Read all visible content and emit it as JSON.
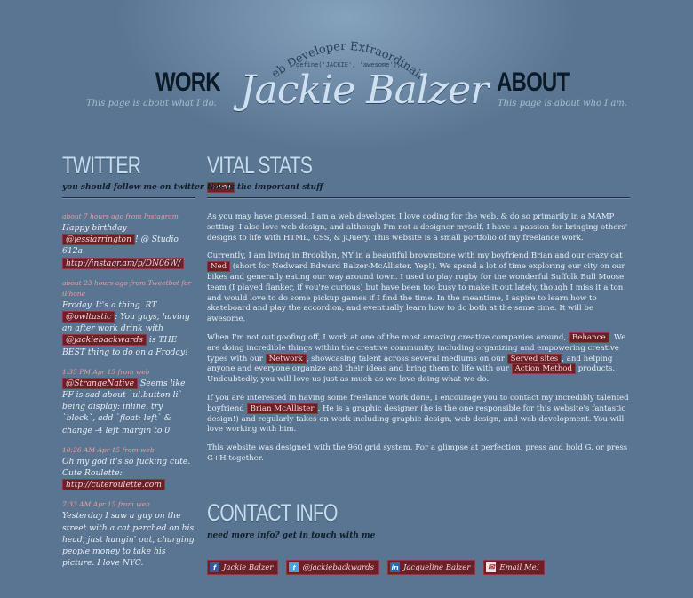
{
  "header": {
    "tagline": "Web Developer Extraordinaire",
    "code": "define('JACKIE', 'awesome');",
    "name": "Jackie Balzer",
    "work": {
      "title": "WORK",
      "subtitle": "This page is about what I do."
    },
    "about": {
      "title": "ABOUT",
      "subtitle": "This page is about who I am."
    }
  },
  "twitter": {
    "heading": "TWITTER",
    "sub_prefix": "you should follow me on twitter",
    "sub_link": "here",
    "tweets": [
      {
        "meta": "about 7 hours ago from Instagram",
        "t1": "Happy birthday ",
        "l1": "@jessiarrington",
        "t2": "! @ Studio 612a ",
        "l2": "http://instagr.am/p/DN06W/",
        "t3": ""
      },
      {
        "meta": "about 23 hours ago from Tweetbot for iPhone",
        "t1": "Froday. It's a thing. RT ",
        "l1": "@owltastic",
        "t2": ": You guys, having an after work drink with ",
        "l2": "@jackiebackwards",
        "t3": " is THE BEST thing to do on a Froday!"
      },
      {
        "meta": "1:35 PM Apr 15 from web",
        "t1": "",
        "l1": "@StrangeNative",
        "t2": " Seems like FF is sad about `ul.button li` being display: inline. try `block`, add `float: left` & change -4 left margin to 0",
        "l2": "",
        "t3": ""
      },
      {
        "meta": "10:26 AM Apr 15 from web",
        "t1": "Oh my god it's so fucking cute. Cute Roulette: ",
        "l1": "http://cuteroulette.com",
        "t2": "",
        "l2": "",
        "t3": ""
      },
      {
        "meta": "7:33 AM Apr 15 from web",
        "t1": "Yesterday I saw a guy on the street with a cat perched on his head, just hangin' out, charging people money to take his picture. I love NYC.",
        "l1": "",
        "t2": "",
        "l2": "",
        "t3": ""
      }
    ]
  },
  "vital": {
    "heading": "VITAL STATS",
    "sub": "this is the important stuff",
    "p1": "As you may have guessed, I am a web developer. I love coding for the web, & do so primarily in a MAMP setting. I also love web design, and although I'm not a designer myself, I have a passion for bringing others' designs to life with HTML, CSS, & jQuery. This website is a small portfolio of my freelance work.",
    "p2a": "Currently, I am living in Brooklyn, NY in a beautiful brownstone with my boyfriend Brian and our crazy cat ",
    "p2link": "Ned",
    "p2b": " (short for Nedward Edward Balzer-McAllister. Yep!). We spend a lot of time exploring our city on our bikes and generally eating our way around town. I used to play rugby for the wonderful Suffolk Bull Moose team (I played flanker, if you're curious) but have been too busy to make it out lately, though I miss it a ton and would love to do some pickup games if I find the time. In the meantime, I aspire to learn how to skateboard and play the accordion, and eventually learn how to do both at the same time. It will be awesome.",
    "p3a": "When I'm not out goofing off, I work at one of the most amazing creative companies around, ",
    "p3l1": "Behance",
    "p3b": ". We are doing incredible things within the creative community, including organizing and empowering creative types with our ",
    "p3l2": "Network",
    "p3c": ", showcasing talent across several mediums on our ",
    "p3l3": "Served sites",
    "p3d": ", and helping anyone and everyone organize and their ideas and bring them to life with our ",
    "p3l4": "Action Method",
    "p3e": " products. Undoubtedly, you will love us just as much as we love doing what we do.",
    "p4a": "If you are interested in having some freelance work done, I encourage you to contact my incredibly talented boyfriend ",
    "p4link": "Brian McAllister",
    "p4b": ". He is a graphic designer (he is the one responsible for this website's fantastic design!) and regularly takes on work including graphic design, web design, and web development. You will love working with him.",
    "p5": "This website was designed with the 960 grid system. For a glimpse at perfection, press and hold G, or press G+H together."
  },
  "contact": {
    "heading": "CONTACT INFO",
    "sub": "need more info? get in touch with me",
    "links": [
      {
        "icon": "facebook-icon",
        "label": "Jackie Balzer"
      },
      {
        "icon": "twitter-icon",
        "label": "@jackiebackwards"
      },
      {
        "icon": "linkedin-icon",
        "label": "Jacqueline Balzer"
      },
      {
        "icon": "mail-icon",
        "label": "Email Me!"
      }
    ]
  },
  "colors": {
    "background": "#5a7592",
    "link_bg": "#6b1f26",
    "heading": "#c6dced",
    "nav_title": "#0c1a28"
  }
}
